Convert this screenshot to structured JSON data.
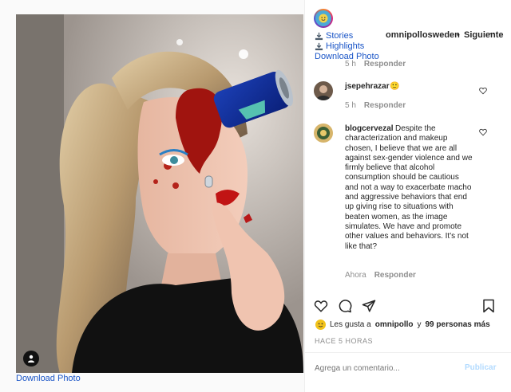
{
  "post": {
    "download_label": "Download Photo"
  },
  "header": {
    "links": {
      "stories": "Stories",
      "highlights": "Highlights",
      "download": "Download Photo"
    },
    "username": "omnipollosweden",
    "separator": "•",
    "follow_label": "Siguiente",
    "more_icon": "ellipsis-icon"
  },
  "comments": [
    {
      "time": "5 h",
      "reply": "Responder"
    },
    {
      "username": "jsepehrazar",
      "text": "🙂",
      "time": "5 h",
      "reply": "Responder"
    },
    {
      "username": "blogcervezal",
      "text": "Despite the characterization and makeup chosen, I believe that we are all against sex-gender violence and we firmly believe that alcohol consumption should be cautious and not a way to exacerbate macho and aggressive behaviors that end up giving rise to situations with beaten women, as the image simulates. We have and promote other values and behaviors. It's not like that?",
      "time": "Ahora",
      "reply": "Responder"
    }
  ],
  "likes": {
    "prefix": "Les gusta a",
    "user": "omnipollo",
    "joiner": "y",
    "others": "99 personas más"
  },
  "timestamp": "HACE 5 HORAS",
  "composer": {
    "placeholder": "Agrega un comentario...",
    "publish_label": "Publicar"
  },
  "colors": {
    "link": "#1a55c7",
    "muted": "#8e8e8e",
    "publish_disabled": "#b3dbff"
  }
}
